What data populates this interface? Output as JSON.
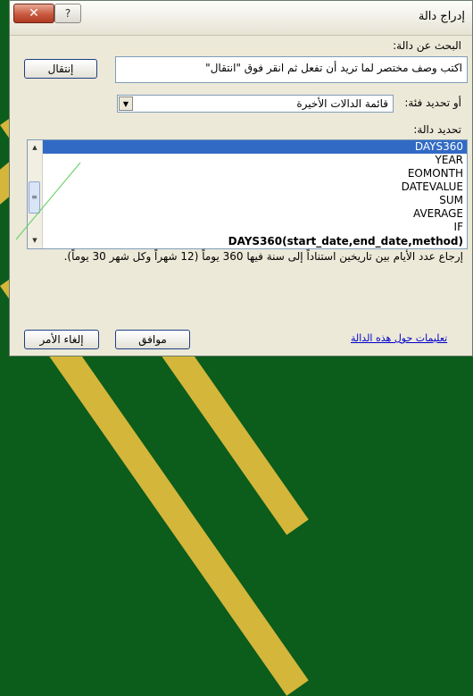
{
  "dialog": {
    "title": "إدراج دالة",
    "close_label": "✕",
    "help_label": "?"
  },
  "search": {
    "label": "البحث عن دالة:",
    "value": "اكتب وصف مختصر لما تريد أن تفعل ثم انقر فوق \"انتقال\"",
    "go_label": "إنتقال"
  },
  "category": {
    "label": "أو تحديد فئة:",
    "value": "قائمة الدالات الأخيرة"
  },
  "function_list": {
    "label": "تحديد دالة:",
    "items": [
      "DAYS360",
      "YEAR",
      "EOMONTH",
      "DATEVALUE",
      "SUM",
      "AVERAGE",
      "IF"
    ],
    "selected": "DAYS360"
  },
  "function_info": {
    "syntax": "DAYS360(start_date,end_date,method)",
    "description": "إرجاع عدد الأيام بين تاريخين استناداً إلى سنة فيها 360 يوماً (12 شهراً وكل شهر 30 يوماً)."
  },
  "footer": {
    "help_link": "تعليمات حول هذه الدالة",
    "ok_label": "موافق",
    "cancel_label": "إلغاء الأمر"
  },
  "colors": {
    "slide_background": "#0c5c1c",
    "slide_stripe": "#d4b63a",
    "selection": "#316ac5",
    "button_border": "#1e3f85"
  },
  "icons": {
    "close": "close-icon",
    "help": "help-icon",
    "dropdown": "chevron-down-icon",
    "scroll_up": "arrow-up-icon",
    "scroll_down": "arrow-down-icon",
    "grip": "scroll-grip-icon"
  }
}
